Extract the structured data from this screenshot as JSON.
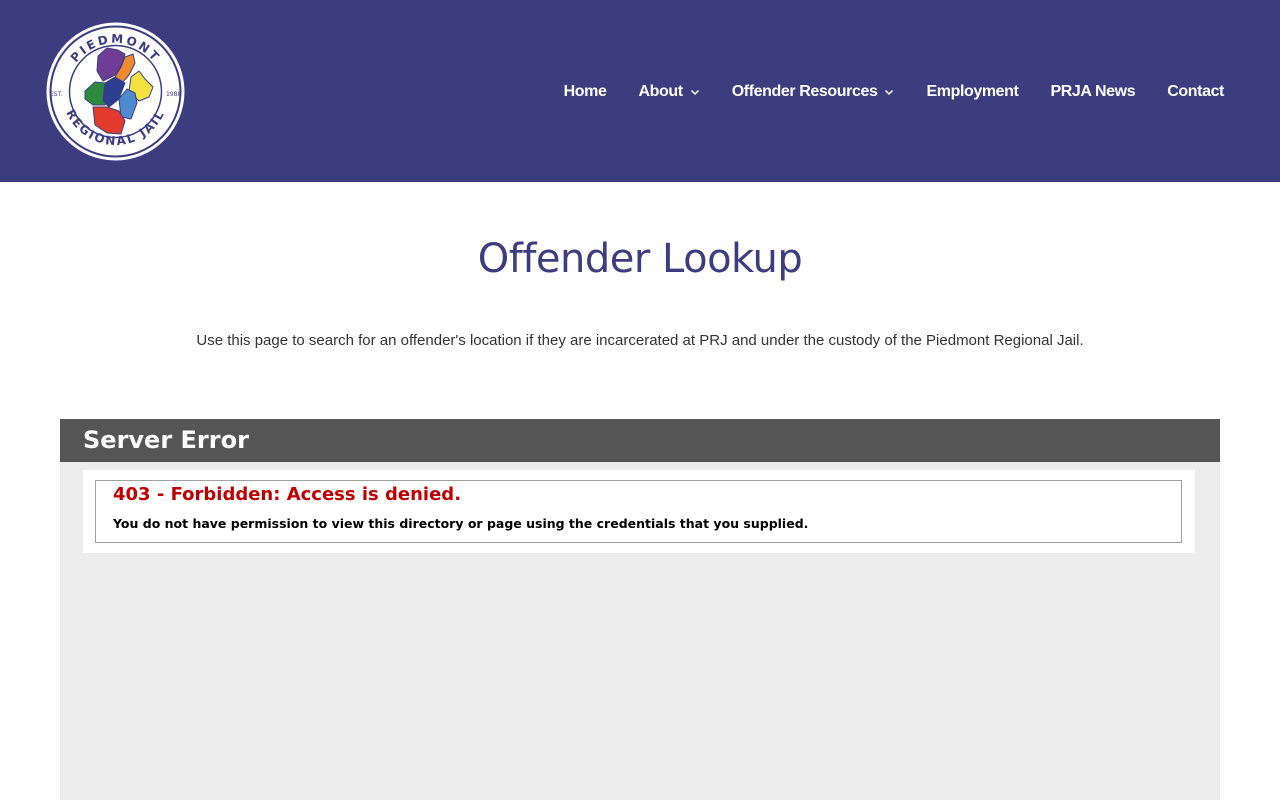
{
  "header": {
    "logo": {
      "top_text": "PIEDMONT",
      "bottom_text": "REGIONAL JAIL",
      "left_text": "EST.",
      "right_text": "1988"
    },
    "nav": [
      {
        "label": "Home",
        "has_dropdown": false
      },
      {
        "label": "About",
        "has_dropdown": true
      },
      {
        "label": "Offender Resources",
        "has_dropdown": true
      },
      {
        "label": "Employment",
        "has_dropdown": false
      },
      {
        "label": "PRJA News",
        "has_dropdown": false
      },
      {
        "label": "Contact",
        "has_dropdown": false
      }
    ]
  },
  "main": {
    "title": "Offender Lookup",
    "intro": "Use this page to search for an offender's location if they are incarcerated at PRJ and under the custody of the Piedmont Regional Jail."
  },
  "error_panel": {
    "heading": "Server Error",
    "error_title": "403 - Forbidden: Access is denied.",
    "error_message": "You do not have permission to view this directory or page using the credentials that you supplied."
  },
  "colors": {
    "header_bg": "#3b3d7f",
    "title_color": "#3b3d7f",
    "panel_head_bg": "#555555",
    "panel_bg": "#ededed",
    "error_red": "#c00000"
  },
  "icons": {
    "dropdown": "chevron-down-icon",
    "logo": "piedmont-regional-jail-seal"
  }
}
